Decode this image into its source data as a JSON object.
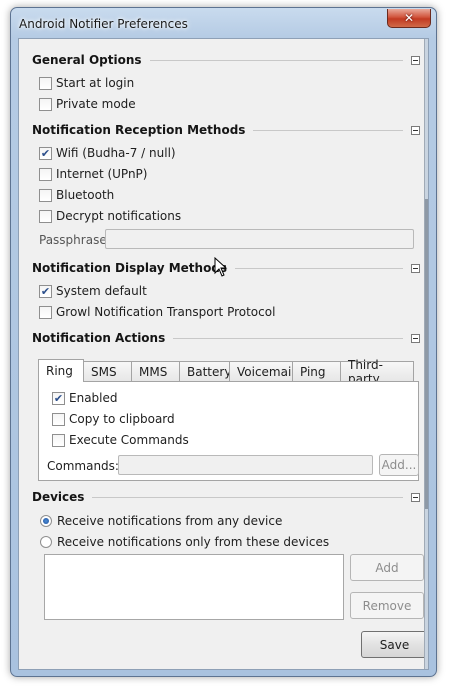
{
  "window": {
    "title": "Android Notifier Preferences",
    "close_glyph": "✕"
  },
  "general": {
    "title": "General Options",
    "start_at_login": {
      "label": "Start at login",
      "checked": false
    },
    "private_mode": {
      "label": "Private mode",
      "checked": false
    }
  },
  "reception": {
    "title": "Notification Reception Methods",
    "wifi": {
      "label": "Wifi (Budha-7 / null)",
      "checked": true
    },
    "internet": {
      "label": "Internet (UPnP)",
      "checked": false
    },
    "bluetooth": {
      "label": "Bluetooth",
      "checked": false
    },
    "decrypt": {
      "label": "Decrypt notifications",
      "checked": false
    },
    "passphrase_label": "Passphrase:",
    "passphrase_value": ""
  },
  "display": {
    "title": "Notification Display Methods",
    "system_default": {
      "label": "System default",
      "checked": true
    },
    "growl": {
      "label": "Growl Notification Transport Protocol",
      "checked": false
    }
  },
  "actions": {
    "title": "Notification Actions",
    "tabs": [
      "Ring",
      "SMS",
      "MMS",
      "Battery",
      "Voicemail",
      "Ping",
      "Third-party"
    ],
    "active_tab": "Ring",
    "enabled": {
      "label": "Enabled",
      "checked": true
    },
    "copy_to_clipboard": {
      "label": "Copy to clipboard",
      "checked": false
    },
    "execute_commands": {
      "label": "Execute Commands",
      "checked": false
    },
    "commands_label": "Commands:",
    "commands_value": "",
    "add_label": "Add..."
  },
  "devices": {
    "title": "Devices",
    "any_device": {
      "label": "Receive notifications from any device",
      "selected": true
    },
    "only_these": {
      "label": "Receive notifications only from these devices",
      "selected": false
    },
    "add_label": "Add",
    "remove_label": "Remove"
  },
  "footer": {
    "save_label": "Save"
  },
  "check_glyph": "✔",
  "colors": {
    "accent": "#2b4e8b",
    "frame": "#a9c2df",
    "close": "#c23a22"
  }
}
